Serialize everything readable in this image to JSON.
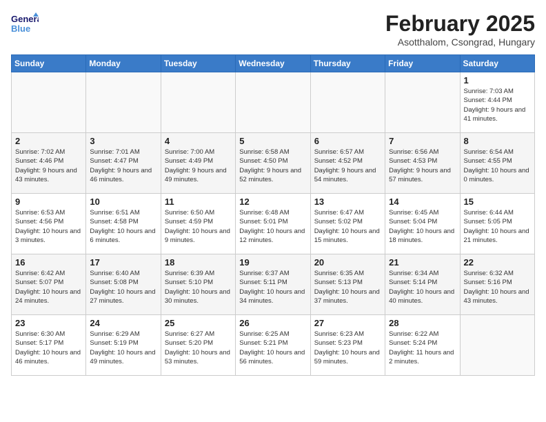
{
  "header": {
    "logo_general": "General",
    "logo_blue": "Blue",
    "month_title": "February 2025",
    "subtitle": "Asotthalom, Csongrad, Hungary"
  },
  "weekdays": [
    "Sunday",
    "Monday",
    "Tuesday",
    "Wednesday",
    "Thursday",
    "Friday",
    "Saturday"
  ],
  "weeks": [
    [
      {
        "day": "",
        "info": ""
      },
      {
        "day": "",
        "info": ""
      },
      {
        "day": "",
        "info": ""
      },
      {
        "day": "",
        "info": ""
      },
      {
        "day": "",
        "info": ""
      },
      {
        "day": "",
        "info": ""
      },
      {
        "day": "1",
        "info": "Sunrise: 7:03 AM\nSunset: 4:44 PM\nDaylight: 9 hours and 41 minutes."
      }
    ],
    [
      {
        "day": "2",
        "info": "Sunrise: 7:02 AM\nSunset: 4:46 PM\nDaylight: 9 hours and 43 minutes."
      },
      {
        "day": "3",
        "info": "Sunrise: 7:01 AM\nSunset: 4:47 PM\nDaylight: 9 hours and 46 minutes."
      },
      {
        "day": "4",
        "info": "Sunrise: 7:00 AM\nSunset: 4:49 PM\nDaylight: 9 hours and 49 minutes."
      },
      {
        "day": "5",
        "info": "Sunrise: 6:58 AM\nSunset: 4:50 PM\nDaylight: 9 hours and 52 minutes."
      },
      {
        "day": "6",
        "info": "Sunrise: 6:57 AM\nSunset: 4:52 PM\nDaylight: 9 hours and 54 minutes."
      },
      {
        "day": "7",
        "info": "Sunrise: 6:56 AM\nSunset: 4:53 PM\nDaylight: 9 hours and 57 minutes."
      },
      {
        "day": "8",
        "info": "Sunrise: 6:54 AM\nSunset: 4:55 PM\nDaylight: 10 hours and 0 minutes."
      }
    ],
    [
      {
        "day": "9",
        "info": "Sunrise: 6:53 AM\nSunset: 4:56 PM\nDaylight: 10 hours and 3 minutes."
      },
      {
        "day": "10",
        "info": "Sunrise: 6:51 AM\nSunset: 4:58 PM\nDaylight: 10 hours and 6 minutes."
      },
      {
        "day": "11",
        "info": "Sunrise: 6:50 AM\nSunset: 4:59 PM\nDaylight: 10 hours and 9 minutes."
      },
      {
        "day": "12",
        "info": "Sunrise: 6:48 AM\nSunset: 5:01 PM\nDaylight: 10 hours and 12 minutes."
      },
      {
        "day": "13",
        "info": "Sunrise: 6:47 AM\nSunset: 5:02 PM\nDaylight: 10 hours and 15 minutes."
      },
      {
        "day": "14",
        "info": "Sunrise: 6:45 AM\nSunset: 5:04 PM\nDaylight: 10 hours and 18 minutes."
      },
      {
        "day": "15",
        "info": "Sunrise: 6:44 AM\nSunset: 5:05 PM\nDaylight: 10 hours and 21 minutes."
      }
    ],
    [
      {
        "day": "16",
        "info": "Sunrise: 6:42 AM\nSunset: 5:07 PM\nDaylight: 10 hours and 24 minutes."
      },
      {
        "day": "17",
        "info": "Sunrise: 6:40 AM\nSunset: 5:08 PM\nDaylight: 10 hours and 27 minutes."
      },
      {
        "day": "18",
        "info": "Sunrise: 6:39 AM\nSunset: 5:10 PM\nDaylight: 10 hours and 30 minutes."
      },
      {
        "day": "19",
        "info": "Sunrise: 6:37 AM\nSunset: 5:11 PM\nDaylight: 10 hours and 34 minutes."
      },
      {
        "day": "20",
        "info": "Sunrise: 6:35 AM\nSunset: 5:13 PM\nDaylight: 10 hours and 37 minutes."
      },
      {
        "day": "21",
        "info": "Sunrise: 6:34 AM\nSunset: 5:14 PM\nDaylight: 10 hours and 40 minutes."
      },
      {
        "day": "22",
        "info": "Sunrise: 6:32 AM\nSunset: 5:16 PM\nDaylight: 10 hours and 43 minutes."
      }
    ],
    [
      {
        "day": "23",
        "info": "Sunrise: 6:30 AM\nSunset: 5:17 PM\nDaylight: 10 hours and 46 minutes."
      },
      {
        "day": "24",
        "info": "Sunrise: 6:29 AM\nSunset: 5:19 PM\nDaylight: 10 hours and 49 minutes."
      },
      {
        "day": "25",
        "info": "Sunrise: 6:27 AM\nSunset: 5:20 PM\nDaylight: 10 hours and 53 minutes."
      },
      {
        "day": "26",
        "info": "Sunrise: 6:25 AM\nSunset: 5:21 PM\nDaylight: 10 hours and 56 minutes."
      },
      {
        "day": "27",
        "info": "Sunrise: 6:23 AM\nSunset: 5:23 PM\nDaylight: 10 hours and 59 minutes."
      },
      {
        "day": "28",
        "info": "Sunrise: 6:22 AM\nSunset: 5:24 PM\nDaylight: 11 hours and 2 minutes."
      },
      {
        "day": "",
        "info": ""
      }
    ]
  ]
}
